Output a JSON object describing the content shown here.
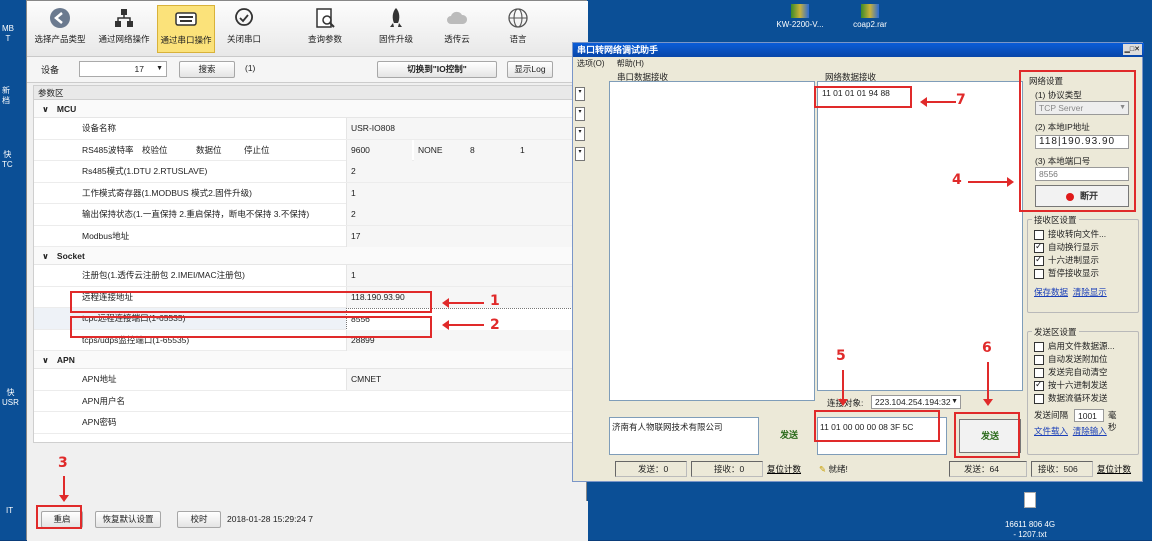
{
  "left_app": {
    "toolbar": [
      {
        "label": "选择产品类型"
      },
      {
        "label": "通过网络操作"
      },
      {
        "label": "通过串口操作"
      },
      {
        "label": "关闭串口"
      },
      {
        "label": "查询参数"
      },
      {
        "label": "固件升级"
      },
      {
        "label": "透传云"
      },
      {
        "label": "语言"
      }
    ],
    "device_label": "设备",
    "device_value": "17",
    "search_btn": "搜索",
    "search_count": "(1)",
    "switch_btn": "切换到\"IO控制\"",
    "log_btn": "显示Log",
    "param_header": "参数区",
    "sections": {
      "mcu": "MCU",
      "socket": "Socket",
      "apn": "APN"
    },
    "mcu_rows": [
      {
        "k": "设备名称",
        "v": "USR-IO808"
      },
      {
        "k": "Rs485模式(1.DTU 2.RTUSLAVE)",
        "v": "2"
      },
      {
        "k": "工作模式寄存器(1.MODBUS 模式2.固件升级)",
        "v": "1"
      },
      {
        "k": "输出保持状态(1.一直保持 2.重启保持，断电不保持 3.不保持)",
        "v": "2"
      },
      {
        "k": "Modbus地址",
        "v": "17"
      }
    ],
    "rs485_row": {
      "k1": "RS485波特率",
      "k2": "校验位",
      "k3": "数据位",
      "k4": "停止位",
      "v1": "9600",
      "v2": "NONE",
      "v3": "8",
      "v4": "1"
    },
    "socket_rows": [
      {
        "k": "注册包(1.透传云注册包 2.IMEI/MAC注册包)",
        "v": "1"
      },
      {
        "k": "远程连接地址",
        "v": "118.190.93.90"
      },
      {
        "k": "tcpc远程连接端口(1-65535)",
        "v": "8556"
      },
      {
        "k": "tcps/udps监控端口(1-65535)",
        "v": "28899"
      }
    ],
    "apn_rows": [
      {
        "k": "APN地址",
        "v": "CMNET"
      },
      {
        "k": "APN用户名",
        "v": ""
      },
      {
        "k": "APN密码",
        "v": ""
      }
    ],
    "bottom": {
      "restart": "重启",
      "restore": "恢复默认设置",
      "timing": "校时",
      "datetime": "2018-01-28 15:29:24 7"
    }
  },
  "right_app": {
    "title": "串口转网络调试助手",
    "menu": [
      "选项(O)",
      "帮助(H)"
    ],
    "serial_recv": "串口数据接收",
    "net_recv": "网络数据接收",
    "net_data": "11 01 01 01 94 88",
    "net_settings": {
      "title": "网络设置",
      "proto_label": "(1) 协议类型",
      "proto": "TCP Server",
      "ip_label": "(2) 本地IP地址",
      "ip": [
        "118",
        "190",
        "93",
        "90"
      ],
      "port_label": "(3) 本地端口号",
      "port": "8556",
      "disconnect": "断开"
    },
    "recv_settings": {
      "title": "接收区设置",
      "items": [
        {
          "t": "接收转向文件...",
          "on": false
        },
        {
          "t": "自动换行显示",
          "on": true
        },
        {
          "t": "十六进制显示",
          "on": true
        },
        {
          "t": "暂停接收显示",
          "on": false
        }
      ],
      "save": "保存数据",
      "clear": "清除显示"
    },
    "send_settings": {
      "title": "发送区设置",
      "items": [
        {
          "t": "启用文件数据源...",
          "on": false
        },
        {
          "t": "自动发送附加位",
          "on": false
        },
        {
          "t": "发送完自动清空",
          "on": false
        },
        {
          "t": "按十六进制发送",
          "on": true
        },
        {
          "t": "数据流循环发送",
          "on": false
        }
      ],
      "interval_label": "发送间隔",
      "interval": "1001",
      "interval_unit": "毫秒",
      "load": "文件载入",
      "clear_input": "清除输入"
    },
    "connect_label": "连接对象:",
    "connect_target": "223.104.254.194:32",
    "serial_send_text": "济南有人物联网技术有限公司",
    "net_send_text": "11 01 00 00 00 08 3F 5C",
    "send_btn": "发送",
    "status": {
      "s_send": "发送：0",
      "s_recv": "接收：0",
      "reset": "复位计数",
      "ready": "就绪!",
      "n_send": "发送：64",
      "n_recv": "接收：506",
      "reset2": "复位计数"
    }
  },
  "annotations": [
    "1",
    "2",
    "3",
    "4",
    "5",
    "6",
    "7"
  ],
  "desktop": {
    "icons": [
      "KW-2200-V...",
      "coap2.rar",
      "16611 806 4G\n- 1207.txt"
    ],
    "left_edge": [
      "MB\nT",
      "新\n档",
      "快\nTC",
      "快\nUSR",
      "IT"
    ]
  }
}
